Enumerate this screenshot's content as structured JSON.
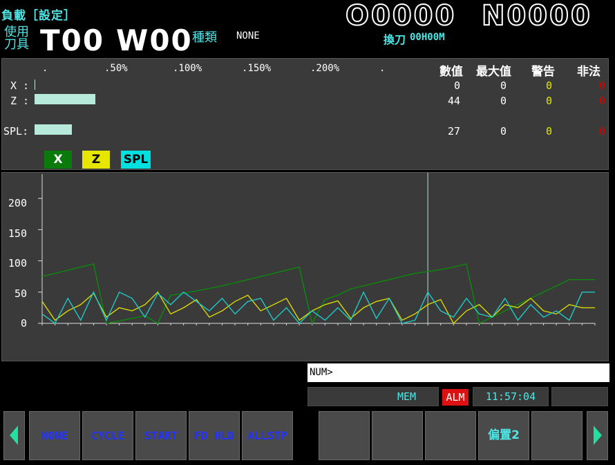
{
  "header": {
    "title": "負載［設定］",
    "tool_label": "使用刀具",
    "tool_no": "T00",
    "wear_no": "W00",
    "type_label": "種類",
    "type_value": "NONE",
    "program_no": "O0000",
    "sequence_no": "N0000",
    "tool_change_label": "換刀",
    "tool_change_value": "00H00M"
  },
  "load_panel": {
    "scale": [
      ".",
      ".50%",
      ".100%",
      ".150%",
      ".200%",
      "."
    ],
    "columns": [
      "數值",
      "最大值",
      "警告",
      "非法"
    ],
    "colors": {
      "bar": "#b7eadb",
      "warning": "#e6e600",
      "illegal": "#dd0000"
    },
    "rows": [
      {
        "label": "X :",
        "value": "0",
        "max": "0",
        "warn": "0",
        "illegal": "0",
        "load_percent": 0
      },
      {
        "label": "Z :",
        "value": "44",
        "max": "0",
        "warn": "0",
        "illegal": "0",
        "load_percent": 44
      },
      {
        "label": "SPL:",
        "value": "27",
        "max": "0",
        "warn": "0",
        "illegal": "0",
        "load_percent": 27
      }
    ],
    "legend": [
      {
        "label": "X",
        "bg": "#0a7a0a",
        "fg": "#ffffff"
      },
      {
        "label": "Z",
        "bg": "#e6e600",
        "fg": "#000000"
      },
      {
        "label": "SPL",
        "bg": "#00e0e0",
        "fg": "#000000"
      }
    ]
  },
  "chart_data": {
    "type": "line",
    "ylim": [
      0,
      230
    ],
    "yticks": [
      "0",
      "50",
      "100",
      "150",
      "200"
    ],
    "x": [
      0,
      1,
      2,
      3,
      4,
      5,
      6,
      7,
      8,
      9,
      10,
      11,
      12,
      13,
      14,
      15,
      16,
      17,
      18,
      19,
      20,
      21,
      22,
      23,
      24,
      25,
      26,
      27,
      28,
      29,
      30,
      31,
      32,
      33,
      34,
      35,
      36,
      37,
      38,
      39,
      40,
      41,
      42,
      43
    ],
    "series": [
      {
        "name": "X",
        "color": "#0a8a0a",
        "values": [
          75,
          80,
          85,
          90,
          95,
          0,
          4,
          8,
          12,
          0,
          45,
          48,
          52,
          56,
          60,
          65,
          70,
          75,
          80,
          85,
          90,
          0,
          38,
          45,
          55,
          60,
          65,
          70,
          75,
          80,
          83,
          86,
          90,
          95,
          0,
          10,
          20,
          30,
          40,
          50,
          60,
          70,
          70,
          70
        ]
      },
      {
        "name": "Z",
        "color": "#d8d800",
        "values": [
          35,
          5,
          20,
          30,
          48,
          10,
          25,
          20,
          30,
          50,
          15,
          25,
          38,
          10,
          20,
          35,
          45,
          20,
          30,
          40,
          5,
          20,
          30,
          36,
          8,
          25,
          35,
          40,
          5,
          15,
          30,
          38,
          0,
          20,
          30,
          10,
          30,
          25,
          40,
          20,
          15,
          30,
          25,
          25
        ]
      },
      {
        "name": "SPL",
        "color": "#20c8c8",
        "values": [
          15,
          0,
          40,
          5,
          50,
          5,
          50,
          40,
          10,
          48,
          30,
          50,
          35,
          20,
          40,
          15,
          35,
          40,
          5,
          25,
          0,
          20,
          5,
          25,
          5,
          50,
          8,
          40,
          0,
          5,
          50,
          20,
          10,
          40,
          15,
          10,
          40,
          5,
          30,
          10,
          20,
          5,
          50,
          50
        ]
      }
    ]
  },
  "input": {
    "prompt": "NUM>"
  },
  "status": {
    "mode": "MEM",
    "alarm": "ALM",
    "time": "11:57:04"
  },
  "softkeys": {
    "left": [
      "NONE",
      "CYCLE",
      "START",
      "FD HLD",
      "ALLSTP"
    ],
    "right": [
      "",
      "",
      "",
      "偏置2",
      ""
    ]
  }
}
